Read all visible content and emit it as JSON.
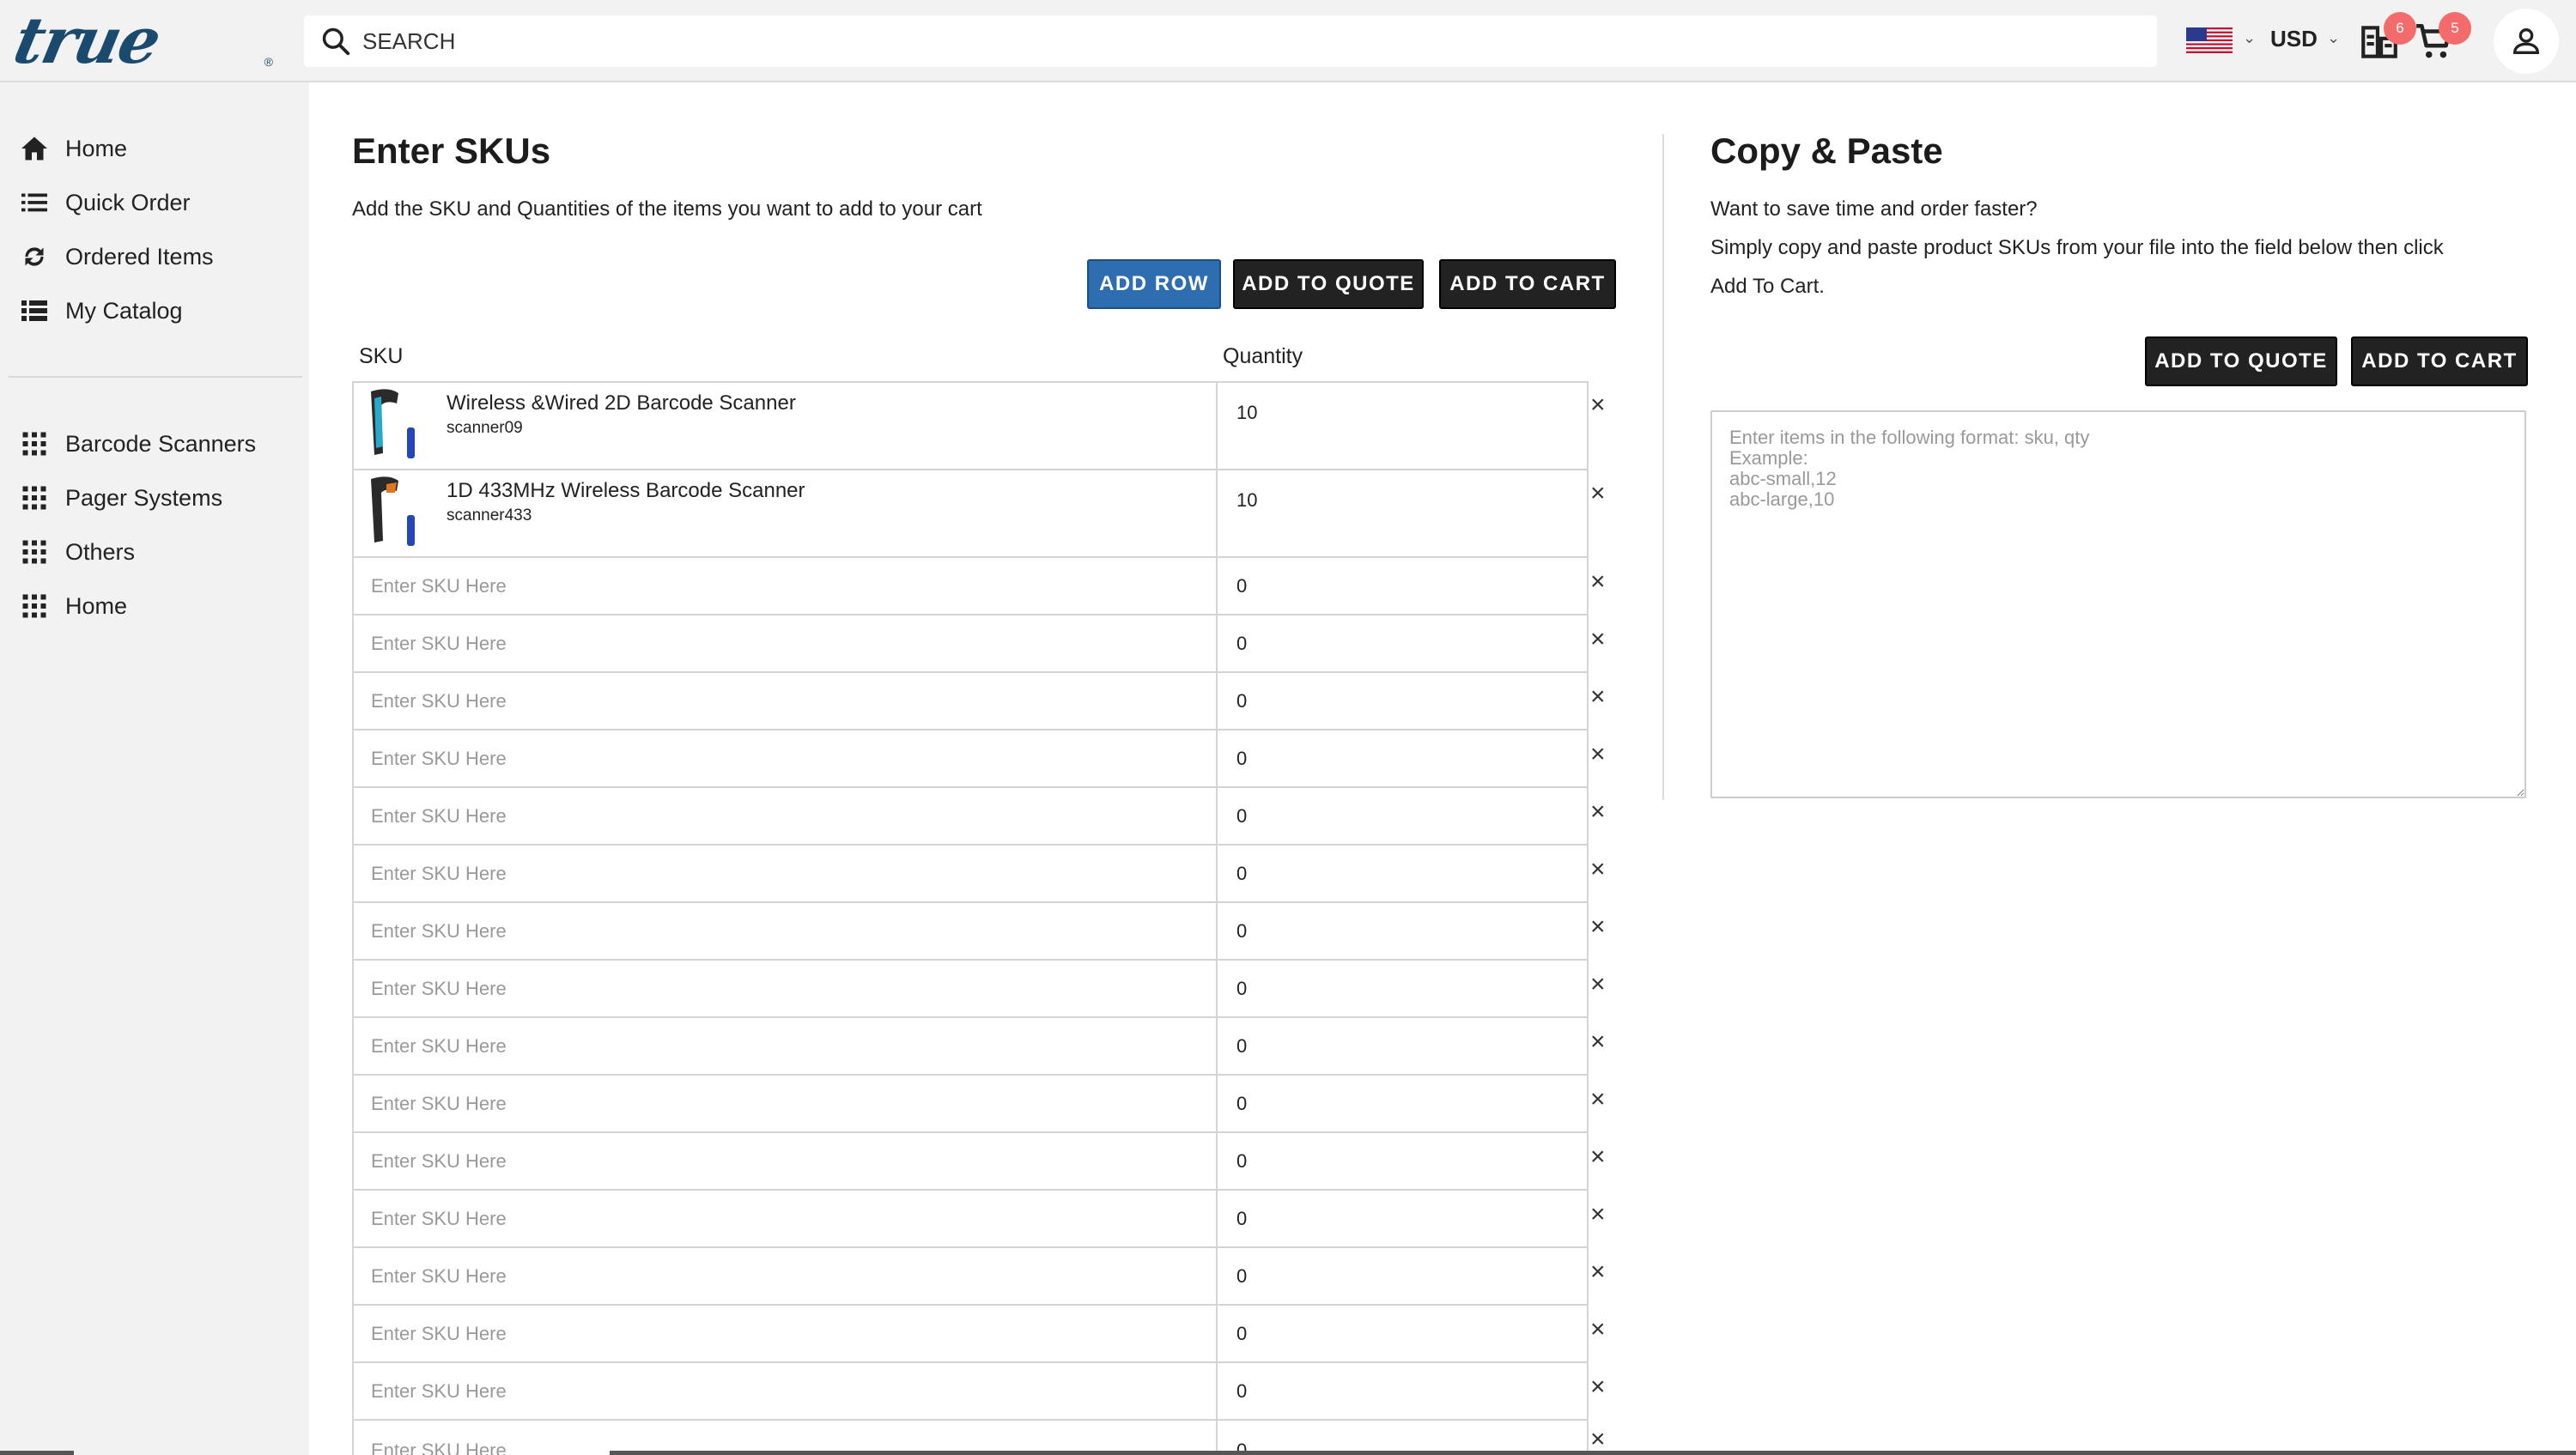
{
  "header": {
    "logo_text": "true",
    "logo_reg": "®",
    "search_placeholder": "SEARCH",
    "flag": "us-flag-icon",
    "currency": "USD",
    "quote_badge": "6",
    "cart_badge": "5"
  },
  "sidebar": {
    "items": [
      {
        "label": "Home",
        "icon": "home-icon"
      },
      {
        "label": "Quick Order",
        "icon": "list-icon"
      },
      {
        "label": "Ordered Items",
        "icon": "refresh-icon"
      },
      {
        "label": "My Catalog",
        "icon": "catalog-icon"
      }
    ],
    "categories": [
      {
        "label": "Barcode Scanners",
        "icon": "grid-icon"
      },
      {
        "label": "Pager Systems",
        "icon": "grid-icon"
      },
      {
        "label": "Others",
        "icon": "grid-icon"
      },
      {
        "label": "Home",
        "icon": "grid-icon"
      }
    ]
  },
  "skus": {
    "title": "Enter SKUs",
    "subtitle": "Add the SKU and Quantities of the items you want to add to your cart",
    "add_row_label": "ADD ROW",
    "add_to_quote_label": "ADD TO QUOTE",
    "add_to_cart_label": "ADD TO CART",
    "col_sku": "SKU",
    "col_qty": "Quantity",
    "products": [
      {
        "name": "Wireless &Wired 2D Barcode Scanner",
        "sku": "scanner09",
        "qty": "10"
      },
      {
        "name": "1D 433MHz Wireless Barcode Scanner",
        "sku": "scanner433",
        "qty": "10"
      }
    ],
    "empty_placeholder": "Enter SKU Here",
    "empty_qty": "0",
    "remove_symbol": "×"
  },
  "paste": {
    "title": "Copy & Paste",
    "line1": "Want to save time and order faster?",
    "line2": "Simply copy and paste product SKUs from your file into the field below then click",
    "line3": "Add To Cart.",
    "add_to_quote_label": "ADD TO QUOTE",
    "add_to_cart_label": "ADD TO CART",
    "placeholder": "Enter items in the following format: sku, qty\nExample:\nabc-small,12\nabc-large,10"
  }
}
